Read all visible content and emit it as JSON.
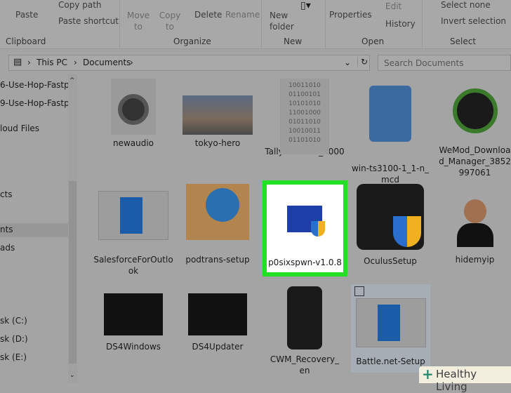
{
  "ribbon": {
    "clipboard": {
      "paste": "Paste",
      "copy_path": "Copy path",
      "paste_shortcut": "Paste shortcut",
      "group": "Clipboard"
    },
    "organize": {
      "move_to": "Move to",
      "copy_to": "Copy to",
      "delete": "Delete",
      "rename": "Rename",
      "group": "Organize"
    },
    "new": {
      "new_folder": "New folder",
      "group": "New"
    },
    "open": {
      "properties": "Properties",
      "edit": "Edit",
      "history": "History",
      "group": "Open"
    },
    "select": {
      "select_none": "Select none",
      "invert_selection": "Invert selection",
      "group": "Select"
    }
  },
  "address": {
    "crumbs": [
      "This PC",
      "Documents"
    ],
    "search_placeholder": "Search Documents"
  },
  "nav": [
    "6-Use-Hop-Fastp",
    "9-Use-Hop-Fastp",
    "loud Files",
    "cts",
    "nts",
    "ads",
    "sk (C:)",
    "sk (D:)",
    "sk (E:)"
  ],
  "files": [
    "newaudio",
    "tokyo-hero",
    "TallyODBC64_9000",
    "win-ts3100-1_1-n_mcd",
    "WeMod_Download_Manager_3852997061",
    "SalesforceForOutlook",
    "podtrans-setup",
    "p0sixspwn-v1.0.8",
    "OculusSetup",
    "hidemyip",
    "DS4Windows",
    "DS4Updater",
    "CWM_Recovery_en",
    "Battle.net-Setup"
  ],
  "watermark": "Healthy Living",
  "colors": {
    "highlight": "#22e022",
    "selected": "#a7adb5"
  }
}
